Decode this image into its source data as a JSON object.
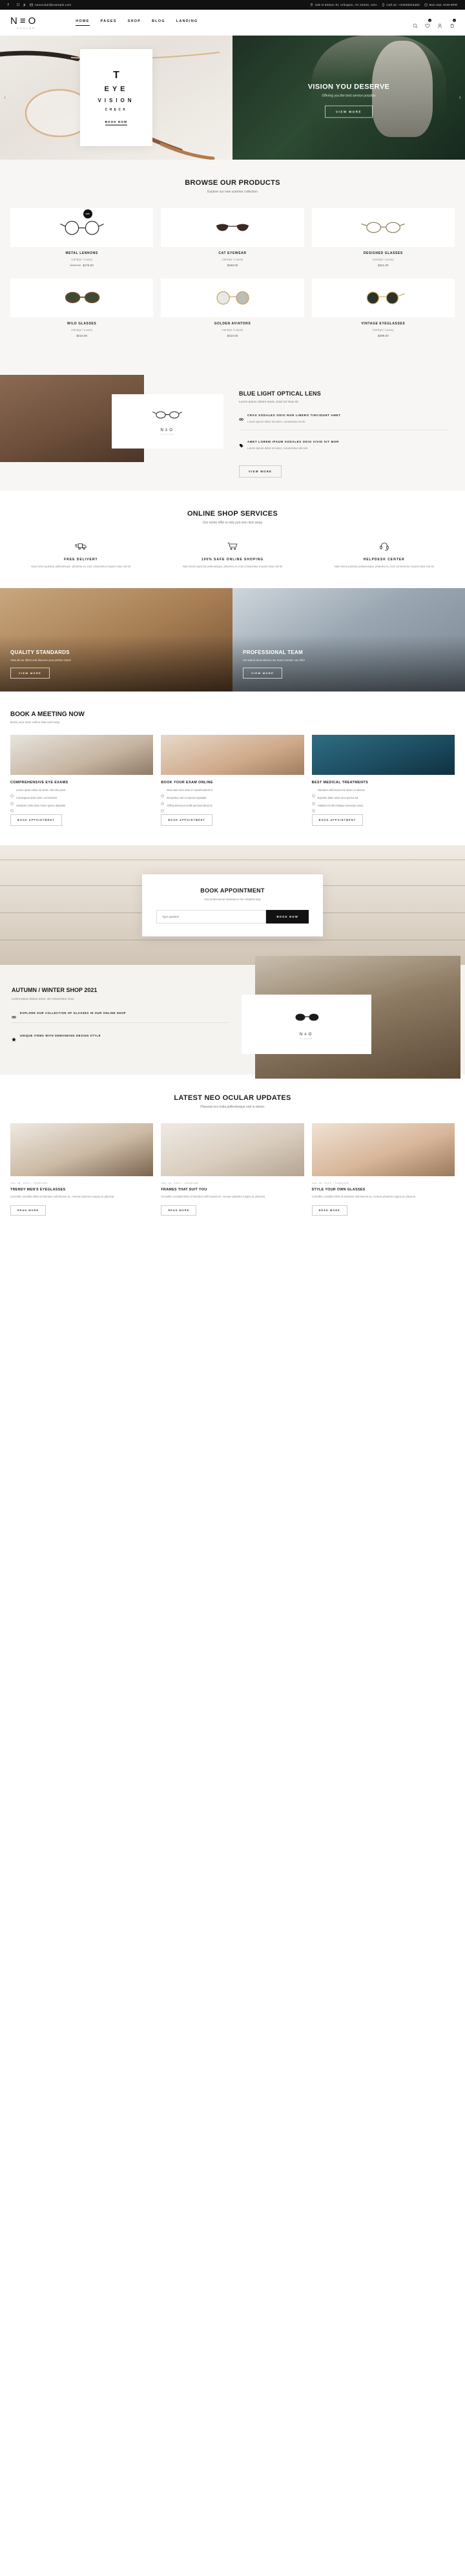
{
  "topbar": {
    "email": "neoocular@example.com",
    "address": "235 N Edison St, Arlington, VA 22203, USA",
    "phone": "Call us: +34936915450",
    "hours": "Mon-Sat: 9AM-9PM",
    "socials": [
      "facebook-icon",
      "twitter-icon",
      "instagram-icon",
      "pinterest-icon"
    ]
  },
  "header": {
    "logo": "N≡O",
    "logo_sub": "OCULAR",
    "nav": [
      {
        "label": "HOME",
        "active": true
      },
      {
        "label": "PAGES",
        "active": false
      },
      {
        "label": "SHOP",
        "active": false
      },
      {
        "label": "BLOG",
        "active": false
      },
      {
        "label": "LANDING",
        "active": false
      }
    ],
    "wishlist_count": "0",
    "cart_count": "0"
  },
  "hero": {
    "left": {
      "letter": "T",
      "line1": "EYE",
      "line2": "VISION",
      "line3": "CHECK",
      "button": "BOOK NOW"
    },
    "right": {
      "title": "VISION YOU DESERVE",
      "subtitle": "Offering you the best service possible",
      "button": "VIEW MORE"
    },
    "prev": "‹",
    "next": "›"
  },
  "products": {
    "title": "BROWSE OUR PRODUCTS",
    "subtitle": "Explore our new summer collection",
    "items": [
      {
        "name": "METAL LENNONS",
        "category": "Cat-Eye / Luxory",
        "price": "$175.00",
        "old_price": "$199.00",
        "sale": "sale",
        "badge": true
      },
      {
        "name": "CAT EYEWEAR",
        "category": "Cat-Eye / Luxory",
        "price": "$199.00",
        "old_price": "",
        "sale": "",
        "badge": false
      },
      {
        "name": "DESIGNED GLASSES",
        "category": "Cat-Eye / Luxory",
        "price": "$211.00",
        "old_price": "",
        "sale": "",
        "badge": false
      },
      {
        "name": "WILD GLASSES",
        "category": "Cat-Eye / Luxory",
        "price": "$215.00",
        "old_price": "",
        "sale": "",
        "badge": false
      },
      {
        "name": "GOLDEN AVIATORS",
        "category": "Cat-Eye / Luxory",
        "price": "$310.00",
        "old_price": "",
        "sale": "",
        "badge": false
      },
      {
        "name": "VINTAGE EYEGLASSES",
        "category": "Cat-Eye / Luxory",
        "price": "$299.00",
        "old_price": "",
        "sale": "",
        "badge": false
      }
    ]
  },
  "bluelight": {
    "title": "BLUE LIGHT OPTICAL LENS",
    "subtitle": "Lorem ipsum dolore amet, vivid vel risus sit",
    "logo": "N≡O",
    "logo_sub": "OCULAR",
    "features": [
      {
        "icon": "glasses-icon",
        "title": "CRAS SODALES ODIO NON LIBERO TINCIDUNT AMET",
        "desc": "Lorem ipsum dolor sit amet, consectetur sit do"
      },
      {
        "icon": "tag-icon",
        "title": "AMET LOREM IPSUM SODALES ODIO VIVID SIT MOR",
        "desc": "Lorem ipsum dolor sit amet, consectetur del sint"
      }
    ],
    "button": "VIEW MORE"
  },
  "services": {
    "title": "ONLINE SHOP SERVICES",
    "subtitle": "Our entire offer is only just one click away",
    "items": [
      {
        "icon": "truck-icon",
        "name": "FREE DELIVERY",
        "desc": "Nam lorem pulvinar pellentesque, pharetra eu cras consectetur maximi vitae nisl sit"
      },
      {
        "icon": "cart-icon",
        "name": "100% SAFE ONLINE SHOPING",
        "desc": "Nam lorem pulvinar pellentesque, pharetra eu cras consectetur maximi vitae nisl sit"
      },
      {
        "icon": "headset-icon",
        "name": "HELPDESK CENTER",
        "desc": "Nam lorem pulvinar pellentesque, pharetra eu cras consectetur maximi vitae nisl sit"
      }
    ]
  },
  "banners": [
    {
      "title": "QUALITY STANDARDS",
      "subtitle": "View all our offers and discover your perfect match",
      "button": "VIEW MORE"
    },
    {
      "title": "PROFESSIONAL TEAM",
      "subtitle": "Get asked what advices our team member can offer",
      "button": "VIEW MORE"
    }
  ],
  "meeting": {
    "title": "BOOK A MEETING NOW",
    "subtitle": "Book your term online fast and easy",
    "cards": [
      {
        "name": "COMPREHENSIVE EYE EXAMS",
        "bullets": [
          "Lorem ipsum dolor sit amet, vivir elit purss",
          "Conseqtuat dolor duis, consectetur",
          "Struktum nirsk dolor lorem ipsum aliquetet"
        ],
        "button": "BOOK APPOINTMENT"
      },
      {
        "name": "BOOK YOUR EXAM ONLINE",
        "bullets": [
          "Duis aute irure dolor in reprehenderit in",
          "Excepteur sint occaecat cupidatat",
          "Officia deserunt mollit anmiest laborum"
        ],
        "button": "BOOK APPOINTMENT"
      },
      {
        "name": "BEST MEDICAL TREATMENTS",
        "bullets": [
          "Interdum velit laoreet id donec in ultrices",
          "Egestas diam amet arcu purrus ad",
          "Habitant morbi tristique senectus netus"
        ],
        "button": "BOOK APPOINTMENT"
      }
    ]
  },
  "appointment": {
    "title": "BOOK APPOINTMENT",
    "subtitle": "Get professional assistance the simplest way",
    "placeholder": "Type question",
    "button": "BOOK NOW"
  },
  "autumn": {
    "title": "AUTUMN / WINTER SHOP 2021",
    "subtitle": "Lorem ipsum dolore amet, vel consectetur risus",
    "logo": "N≡O",
    "logo_sub": "OCULAR",
    "features": [
      {
        "icon": "glasses-icon",
        "title": "EXPLORE OUR COLLECTION OF GLASSES IN OUR ONLINE SHOP"
      },
      {
        "icon": "star-icon",
        "title": "UNIQUE ITEMS WITH DEMANDING DESIGN STYLE"
      }
    ]
  },
  "blog": {
    "title": "LATEST NEO OCULAR UPDATES",
    "subtitle": "Placerat orci nulla pellentesque sed in donec",
    "posts": [
      {
        "meta": "JUL 18, 2021 / FASHION",
        "title": "TRENDY MEN'S EYEGLASSES",
        "desc": "Convallis convallis tellus id interdum velit laoreet ac. Aenean pharetra magna ac placerat",
        "button": "READ MORE"
      },
      {
        "meta": "JUL 18, 2021 / FASHION",
        "title": "FRAMES THAT SUIT YOU",
        "desc": "Convallis convallis tellus id interdum velit laoreet ac. Aenean pharetra magna ac placerat",
        "button": "READ MORE"
      },
      {
        "meta": "JUL 18, 2021 / FASHION",
        "title": "STYLE YOUR OWN GLASSES",
        "desc": "Convallis convallis tellus id interdum velit laoreet ac. Aenean pharetra magna ac placerat",
        "button": "READ MORE"
      }
    ]
  }
}
